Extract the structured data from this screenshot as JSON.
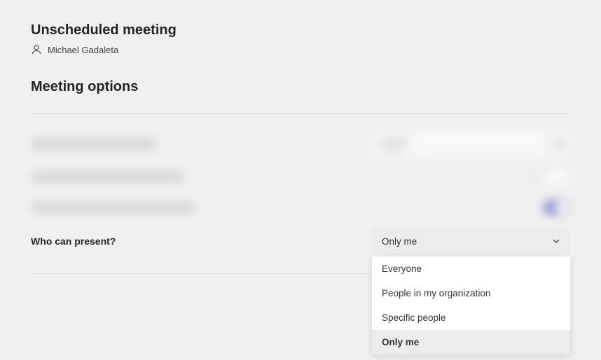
{
  "header": {
    "title": "Unscheduled meeting",
    "organizer": "Michael Gadaleta"
  },
  "section": {
    "title": "Meeting options"
  },
  "presenter": {
    "label": "Who can present?",
    "selected": "Only me",
    "options": [
      "Everyone",
      "People in my organization",
      "Specific people",
      "Only me"
    ]
  }
}
